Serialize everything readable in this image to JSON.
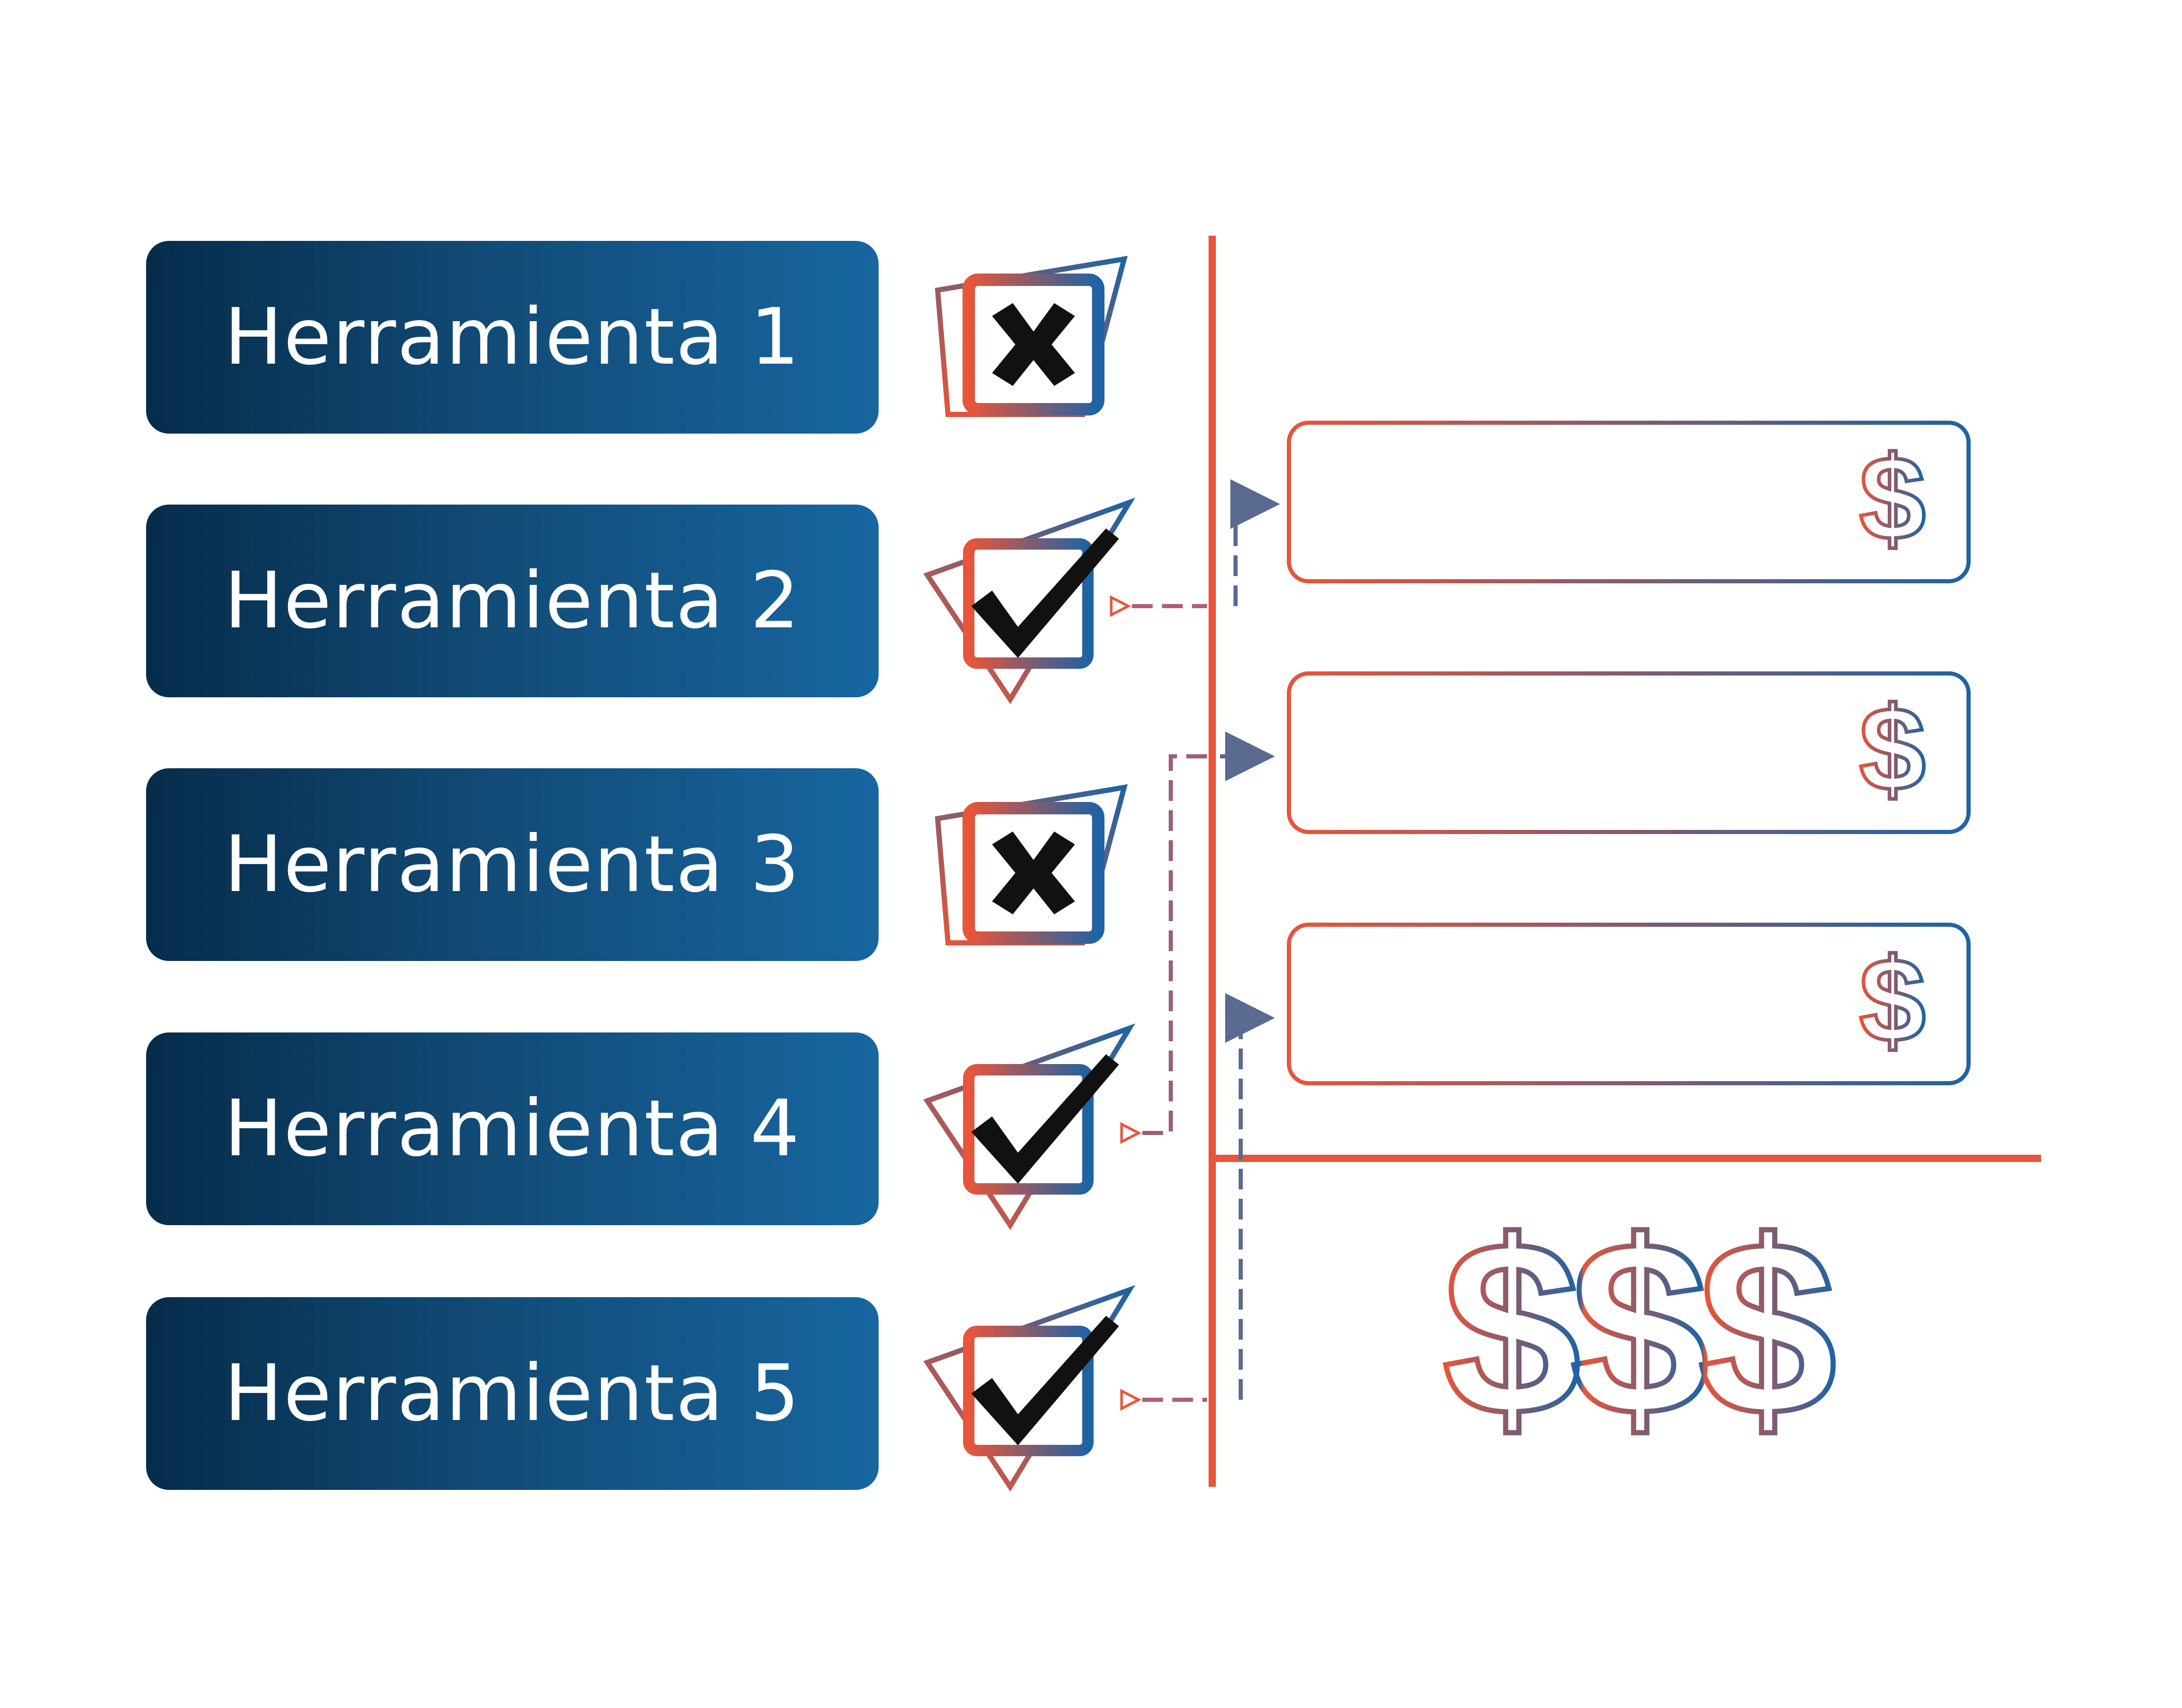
{
  "tools": [
    {
      "label": "Herramienta 1",
      "status": "rejected",
      "icon": "x-mark-icon"
    },
    {
      "label": "Herramienta 2",
      "status": "approved",
      "icon": "check-mark-icon"
    },
    {
      "label": "Herramienta 3",
      "status": "rejected",
      "icon": "x-mark-icon"
    },
    {
      "label": "Herramienta 4",
      "status": "approved",
      "icon": "check-mark-icon"
    },
    {
      "label": "Herramienta 5",
      "status": "approved",
      "icon": "check-mark-icon"
    }
  ],
  "cost_boxes": [
    {
      "symbol": "$",
      "icon": "dollar-icon"
    },
    {
      "symbol": "$",
      "icon": "dollar-icon"
    },
    {
      "symbol": "$",
      "icon": "dollar-icon"
    }
  ],
  "totals": {
    "symbol": "$$$",
    "icon": "dollar-signs-icon"
  },
  "colors": {
    "label_dark": "#062c4a",
    "label_light": "#1766a0",
    "accent_orange": "#e8553a",
    "accent_blue": "#1f63a3",
    "mark_black": "#111111"
  }
}
